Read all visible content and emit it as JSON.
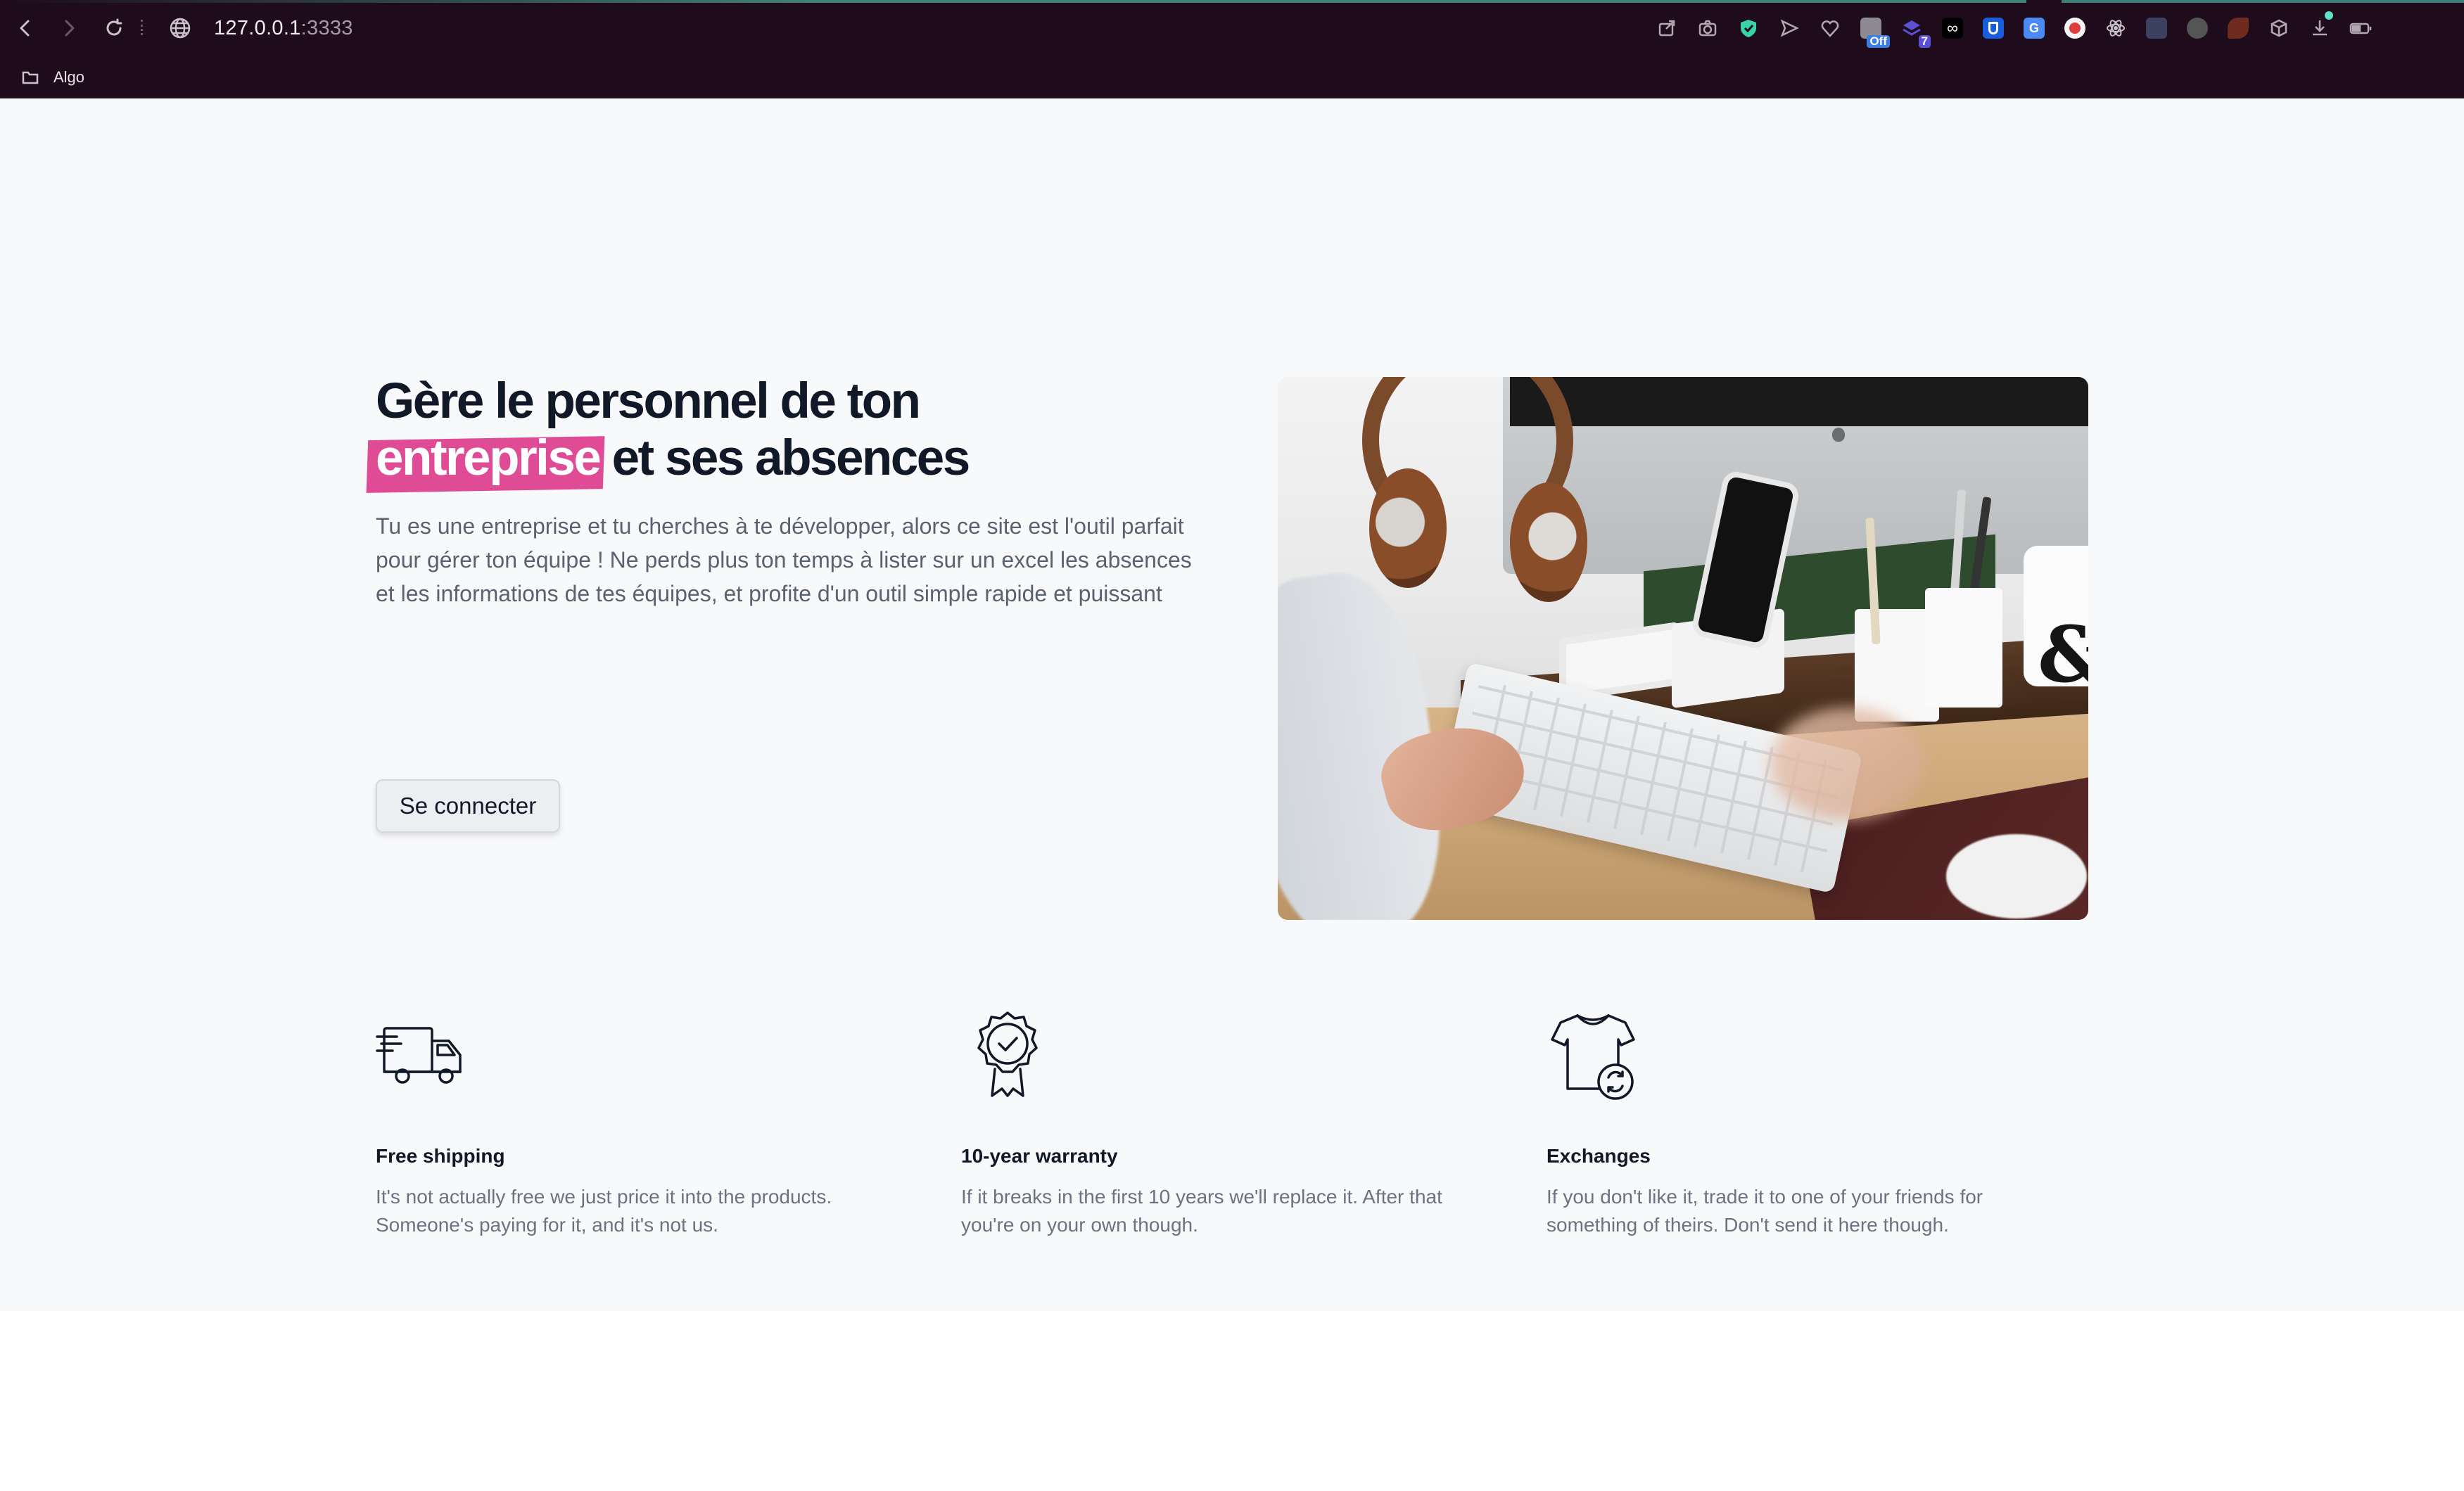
{
  "browser": {
    "url_host": "127.0.0.1",
    "url_port": ":3333",
    "bookmarks": [
      {
        "label": "Algo"
      }
    ],
    "extensions": [
      {
        "icon": "share-icon"
      },
      {
        "icon": "camera-icon"
      },
      {
        "icon": "shield-check-icon"
      },
      {
        "icon": "send-icon"
      },
      {
        "icon": "heart-icon"
      },
      {
        "icon": "privacy-extension-icon",
        "badge": "Off"
      },
      {
        "icon": "layers-extension-icon",
        "badge": "7"
      },
      {
        "icon": "infinity-extension-icon"
      },
      {
        "icon": "bitwarden-icon"
      },
      {
        "icon": "translate-icon"
      },
      {
        "icon": "record-icon"
      },
      {
        "icon": "react-devtools-icon"
      },
      {
        "icon": "grid-extension-icon"
      },
      {
        "icon": "circle-extension-icon"
      },
      {
        "icon": "swift-extension-icon"
      },
      {
        "icon": "cube-icon"
      },
      {
        "icon": "download-icon"
      },
      {
        "icon": "battery-icon"
      }
    ],
    "colors": {
      "chrome_bg": "#1e0b1b",
      "accent_line": "#5fe0c8"
    }
  },
  "hero": {
    "title_line1": "Gère le personnel de ton",
    "title_highlight": "entreprise",
    "title_rest": "et ses absences",
    "description": "Tu es une entreprise et tu cherches à te développer, alors ce site est l'outil parfait pour gérer ton équipe ! Ne perds plus ton temps à lister sur un excel les absences et les informations de tes équipes, et profite d'un outil simple rapide et puissant",
    "login_button": "Se connecter",
    "highlight_color": "#df4c95",
    "image": "desk-workspace-photo"
  },
  "features": [
    {
      "icon": "delivery-truck-icon",
      "title": "Free shipping",
      "text": "It's not actually free we just price it into the products. Someone's paying for it, and it's not us."
    },
    {
      "icon": "warranty-badge-icon",
      "title": "10-year warranty",
      "text": "If it breaks in the first 10 years we'll replace it. After that you're on your own though."
    },
    {
      "icon": "tshirt-exchange-icon",
      "title": "Exchanges",
      "text": "If you don't like it, trade it to one of your friends for something of theirs. Don't send it here though."
    }
  ]
}
